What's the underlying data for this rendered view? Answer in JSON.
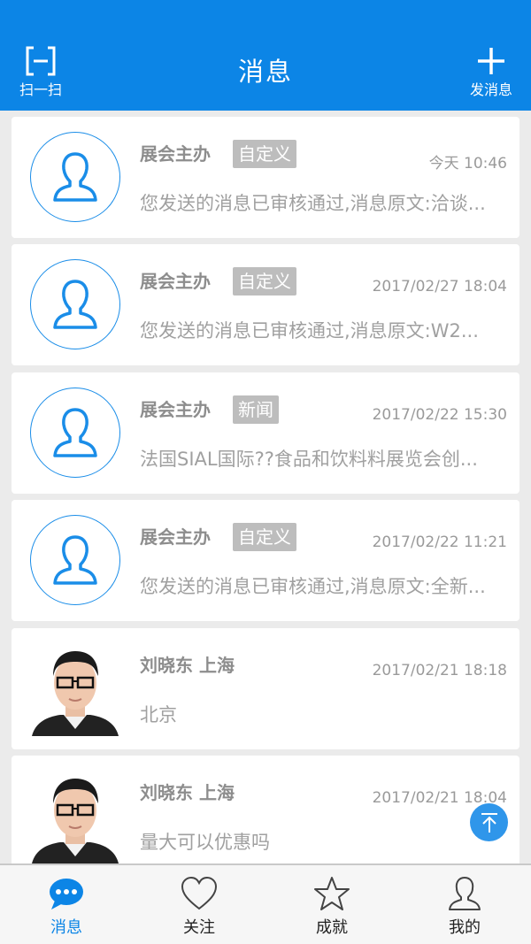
{
  "header": {
    "title": "消息",
    "scan_label": "扫一扫",
    "new_message_label": "发消息"
  },
  "messages": [
    {
      "sender": "展会主办",
      "tag": "自定义",
      "time": "今天 10:46",
      "preview": "您发送的消息已审核通过,消息原文:洽谈...",
      "avatar": "default-user-icon"
    },
    {
      "sender": "展会主办",
      "tag": "自定义",
      "time": "2017/02/27 18:04",
      "preview": "您发送的消息已审核通过,消息原文:W2...",
      "avatar": "default-user-icon"
    },
    {
      "sender": "展会主办",
      "tag": "新闻",
      "time": "2017/02/22 15:30",
      "preview": "法国SIAL国际??食品和饮料料展览会创...",
      "avatar": "default-user-icon"
    },
    {
      "sender": "展会主办",
      "tag": "自定义",
      "time": "2017/02/22 11:21",
      "preview": "您发送的消息已审核通过,消息原文:全新...",
      "avatar": "default-user-icon"
    },
    {
      "sender": "刘晓东 上海",
      "tag": "",
      "time": "2017/02/21 18:18",
      "preview": "北京",
      "avatar": "user-photo"
    },
    {
      "sender": "刘晓东 上海",
      "tag": "",
      "time": "2017/02/21 18:04",
      "preview": "量大可以优惠吗",
      "avatar": "user-photo"
    }
  ],
  "tabs": [
    {
      "label": "消息",
      "icon": "chat-bubble-icon",
      "active": true
    },
    {
      "label": "关注",
      "icon": "heart-icon",
      "active": false
    },
    {
      "label": "成就",
      "icon": "star-icon",
      "active": false
    },
    {
      "label": "我的",
      "icon": "person-icon",
      "active": false
    }
  ],
  "colors": {
    "primary": "#0c85e6",
    "tag_bg": "#bdbdbd",
    "muted_text": "#9a9a9a"
  }
}
